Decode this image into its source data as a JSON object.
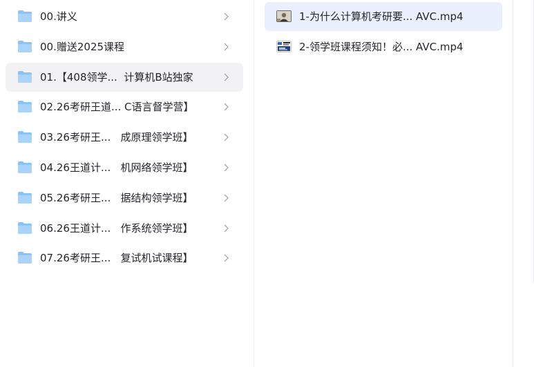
{
  "folders": [
    {
      "label": "00.讲义",
      "icon": "folder-icon"
    },
    {
      "label": "00.赠送2025课程",
      "icon": "folder-icon"
    },
    {
      "label": "01.【408领学...  计算机B站独家",
      "icon": "folder-icon",
      "selected": true
    },
    {
      "label": "02.26考研王道... C语言督学营】",
      "icon": "folder-icon"
    },
    {
      "label": "03.26考研王...   成原理领学班】",
      "icon": "folder-icon"
    },
    {
      "label": "04.26王道计...   机网络领学班】",
      "icon": "folder-icon"
    },
    {
      "label": "05.26考研王...   据结构领学班】",
      "icon": "folder-icon"
    },
    {
      "label": "06.26王道计...   作系统领学班】",
      "icon": "folder-icon"
    },
    {
      "label": "07.26考研王...   复试机试课程】",
      "icon": "folder-icon"
    }
  ],
  "files": [
    {
      "label": "1-为什么计算机考研要... AVC.mp4",
      "icon": "video-thumbnail-icon",
      "selected": true
    },
    {
      "label": "2-领学班课程须知！必... AVC.mp4",
      "icon": "video-thumbnail-icon"
    }
  ],
  "colors": {
    "folder": "#8cc3f7",
    "selected_folder_bg": "#f2f2f4",
    "selected_file_bg": "#eaf0fd",
    "divider": "#ececef"
  }
}
